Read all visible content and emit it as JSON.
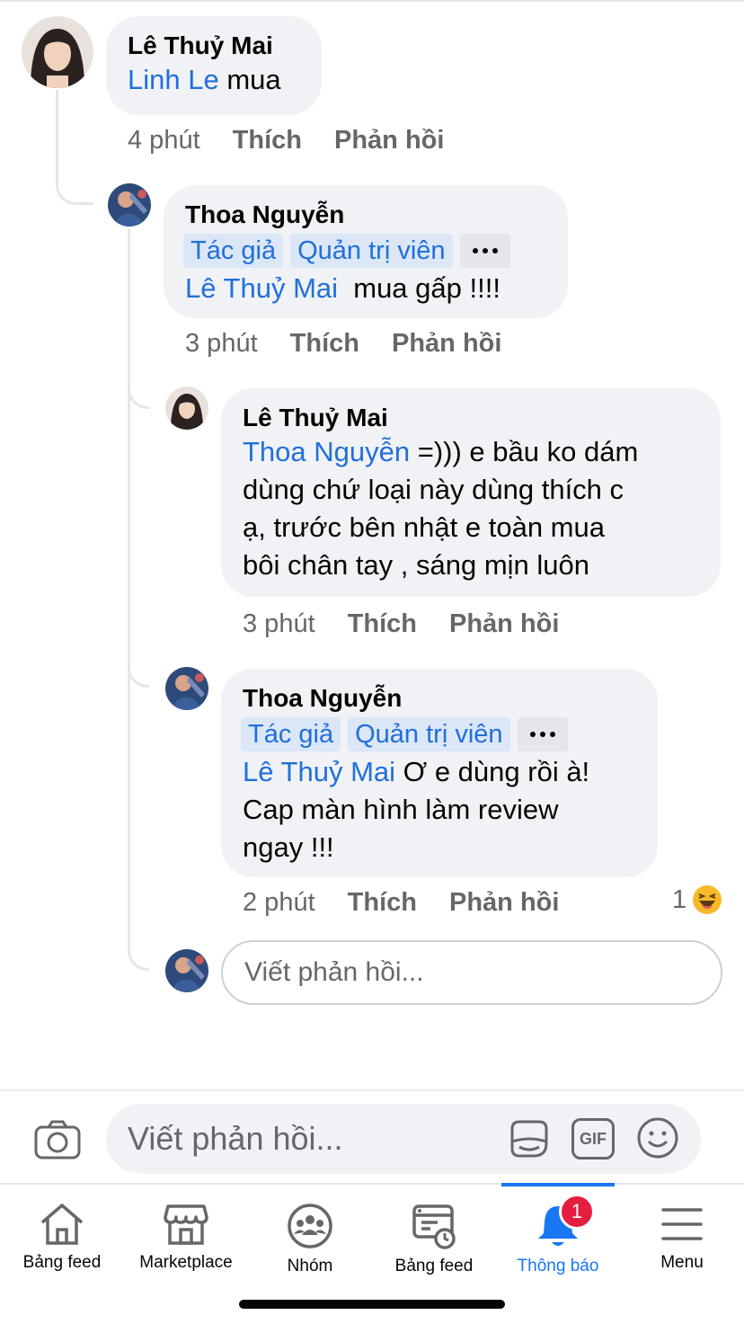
{
  "comments": [
    {
      "author": "Lê Thuỷ Mai",
      "mention": "Linh Le",
      "text": " mua",
      "time": "4 phút",
      "like": "Thích",
      "reply": "Phản hồi"
    },
    {
      "author": "Thoa Nguyễn",
      "badges": [
        "Tác giả",
        "Quản trị viên"
      ],
      "mention": "Lê Thuỷ Mai",
      "text": "  mua gấp !!!!",
      "time": "3 phút",
      "like": "Thích",
      "reply": "Phản hồi"
    },
    {
      "author": "Lê Thuỷ Mai",
      "mention": "Thoa Nguyễn",
      "line1": " =))) e bầu ko dám",
      "line2": "dùng chứ loại này dùng thích c",
      "line3": "ạ, trước bên nhật e toàn mua",
      "line4": "bôi chân tay , sáng mịn luôn",
      "time": "3 phút",
      "like": "Thích",
      "reply": "Phản hồi"
    },
    {
      "author": "Thoa Nguyễn",
      "badges": [
        "Tác giả",
        "Quản trị viên"
      ],
      "mention": "Lê Thuỷ Mai",
      "line1": " Ơ e dùng rồi à!",
      "line2": "Cap màn hình làm review",
      "line3": "ngay !!!",
      "time": "2 phút",
      "like": "Thích",
      "reply": "Phản hồi",
      "reaction_count": "1",
      "reaction_icon": "haha-emoji-icon"
    }
  ],
  "thread_reply_placeholder": "Viết phản hồi...",
  "composer": {
    "placeholder": "Viết phản hồi...",
    "gif_label": "GIF"
  },
  "nav": {
    "items": [
      {
        "label": "Bảng feed",
        "icon": "home-icon"
      },
      {
        "label": "Marketplace",
        "icon": "marketplace-icon"
      },
      {
        "label": "Nhóm",
        "icon": "groups-icon"
      },
      {
        "label": "Bảng feed",
        "icon": "feed-icon"
      },
      {
        "label": "Thông báo",
        "icon": "bell-icon"
      },
      {
        "label": "Menu",
        "icon": "menu-icon"
      }
    ],
    "notification_count": "1",
    "active_color": "#1877f2"
  },
  "colors": {
    "mention": "#216fdb",
    "bubble": "#f0f2f5",
    "badge_bg": "#dbe7f7",
    "meta": "#65676b",
    "notification_badge": "#e41e3f"
  }
}
